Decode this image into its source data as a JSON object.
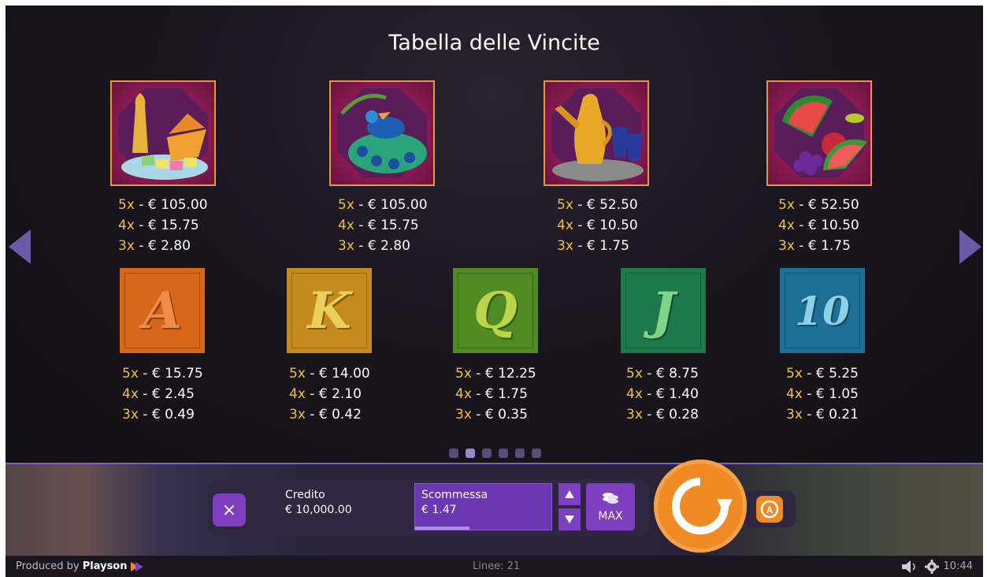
{
  "title": "Tabella delle Vincite",
  "high_symbols": [
    {
      "name": "sweets",
      "pays": [
        {
          "k": "5x",
          "v": "€ 105.00"
        },
        {
          "k": "4x",
          "v": "€ 15.75"
        },
        {
          "k": "3x",
          "v": "€ 2.80"
        }
      ]
    },
    {
      "name": "peacock",
      "pays": [
        {
          "k": "5x",
          "v": "€ 105.00"
        },
        {
          "k": "4x",
          "v": "€ 15.75"
        },
        {
          "k": "3x",
          "v": "€ 2.80"
        }
      ]
    },
    {
      "name": "teapot",
      "pays": [
        {
          "k": "5x",
          "v": "€ 52.50"
        },
        {
          "k": "4x",
          "v": "€ 10.50"
        },
        {
          "k": "3x",
          "v": "€ 1.75"
        }
      ]
    },
    {
      "name": "fruit",
      "pays": [
        {
          "k": "5x",
          "v": "€ 52.50"
        },
        {
          "k": "4x",
          "v": "€ 10.50"
        },
        {
          "k": "3x",
          "v": "€ 1.75"
        }
      ]
    }
  ],
  "card_symbols": [
    {
      "glyph": "A",
      "color": "#d5661a",
      "glyph_color": "#f08c4a",
      "pays": [
        {
          "k": "5x",
          "v": "€ 15.75"
        },
        {
          "k": "4x",
          "v": "€ 2.45"
        },
        {
          "k": "3x",
          "v": "€ 0.49"
        }
      ]
    },
    {
      "glyph": "K",
      "color": "#c68a1c",
      "glyph_color": "#ead05a",
      "pays": [
        {
          "k": "5x",
          "v": "€ 14.00"
        },
        {
          "k": "4x",
          "v": "€ 2.10"
        },
        {
          "k": "3x",
          "v": "€ 0.42"
        }
      ]
    },
    {
      "glyph": "Q",
      "color": "#4f8a22",
      "glyph_color": "#bcd44a",
      "pays": [
        {
          "k": "5x",
          "v": "€ 12.25"
        },
        {
          "k": "4x",
          "v": "€ 1.75"
        },
        {
          "k": "3x",
          "v": "€ 0.35"
        }
      ]
    },
    {
      "glyph": "J",
      "color": "#1c7a4a",
      "glyph_color": "#7ed58a",
      "pays": [
        {
          "k": "5x",
          "v": "€ 8.75"
        },
        {
          "k": "4x",
          "v": "€ 1.40"
        },
        {
          "k": "3x",
          "v": "€ 0.28"
        }
      ]
    },
    {
      "glyph": "10",
      "color": "#1c6f96",
      "glyph_color": "#8ed0e6",
      "pays": [
        {
          "k": "5x",
          "v": "€ 5.25"
        },
        {
          "k": "4x",
          "v": "€ 1.05"
        },
        {
          "k": "3x",
          "v": "€ 0.21"
        }
      ]
    }
  ],
  "pagination": {
    "pages": 6,
    "active": 1
  },
  "controls": {
    "close_icon": "×",
    "credit_label": "Credito",
    "credit_value": "€ 10,000.00",
    "bet_label": "Scommessa",
    "bet_value": "€ 1.47",
    "bet_level": 0.4,
    "max_label": "MAX",
    "auto_label": "A"
  },
  "footer": {
    "produced_prefix": "Produced by",
    "brand": "Playson",
    "lines": "Linee: 21",
    "time": "10:44"
  },
  "colors": {
    "accent": "#7d3fc0",
    "spin": "#f08a24",
    "multiplier": "#f2c03a"
  }
}
